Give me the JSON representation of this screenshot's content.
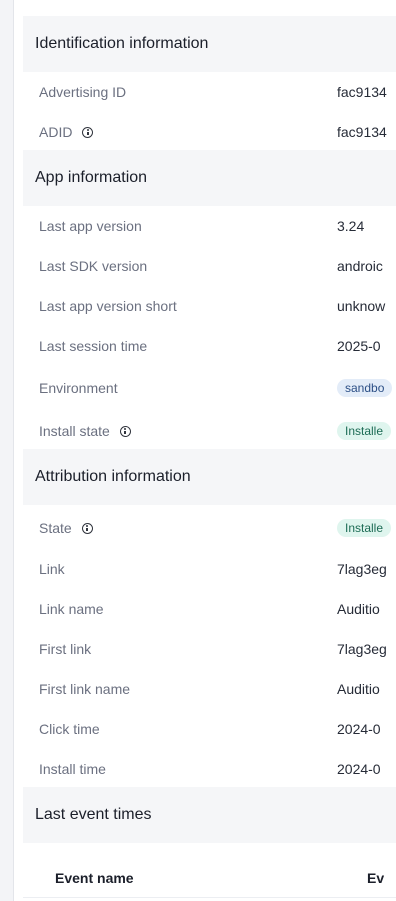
{
  "identification": {
    "title": "Identification information",
    "rows": [
      {
        "label": "Advertising ID",
        "value": "fac9134"
      },
      {
        "label": "ADID",
        "value": "fac9134"
      }
    ]
  },
  "app": {
    "title": "App information",
    "rows": [
      {
        "label": "Last app version",
        "value": "3.24"
      },
      {
        "label": "Last SDK version",
        "value": "androic"
      },
      {
        "label": "Last app version short",
        "value": "unknow"
      },
      {
        "label": "Last session time",
        "value": "2025-0"
      },
      {
        "label": "Environment",
        "value": "sandbo"
      },
      {
        "label": "Install state",
        "value": "Installe"
      }
    ]
  },
  "attribution": {
    "title": "Attribution information",
    "rows": [
      {
        "label": "State",
        "value": "Installe"
      },
      {
        "label": "Link",
        "value": "7lag3eg"
      },
      {
        "label": "Link name",
        "value": "Auditio"
      },
      {
        "label": "First link",
        "value": "7lag3eg"
      },
      {
        "label": "First link name",
        "value": "Auditio"
      },
      {
        "label": "Click time",
        "value": "2024-0"
      },
      {
        "label": "Install time",
        "value": "2024-0"
      }
    ]
  },
  "events": {
    "title": "Last event times",
    "col_event_name": "Event name",
    "col_ev": "Ev"
  },
  "colors": {
    "badge_blue_bg": "#e3ecf8",
    "badge_green_bg": "#dff5ee"
  },
  "icons": [
    "info-icon"
  ]
}
